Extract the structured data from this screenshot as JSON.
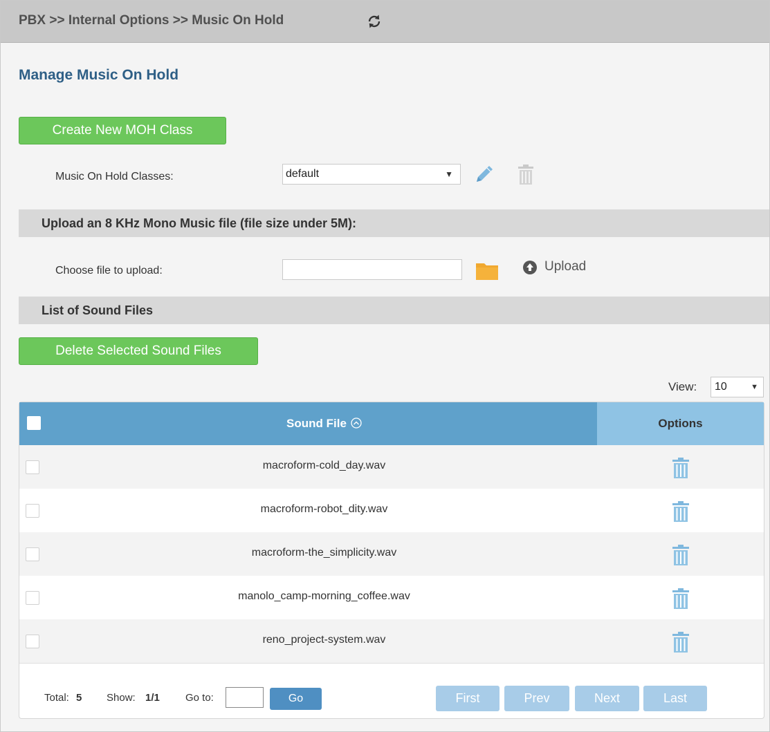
{
  "breadcrumb": "PBX >> Internal Options >> Music On Hold",
  "page_title": "Manage Music On Hold",
  "create_button": "Create New MOH Class",
  "moh_classes": {
    "label": "Music On Hold Classes:",
    "selected": "default"
  },
  "upload_section": {
    "title": "Upload an 8 KHz Mono Music file (file size under 5M):",
    "choose_label": "Choose file to upload:",
    "file_value": "",
    "upload_label": "Upload"
  },
  "list_section": {
    "title": "List of Sound Files"
  },
  "delete_button": "Delete Selected Sound Files",
  "view": {
    "label": "View:",
    "value": "10"
  },
  "table": {
    "headers": {
      "file": "Sound File",
      "options": "Options"
    },
    "rows": [
      {
        "file": "macroform-cold_day.wav"
      },
      {
        "file": "macroform-robot_dity.wav"
      },
      {
        "file": "macroform-the_simplicity.wav"
      },
      {
        "file": "manolo_camp-morning_coffee.wav"
      },
      {
        "file": "reno_project-system.wav"
      }
    ]
  },
  "pagination": {
    "total_label": "Total:",
    "total": "5",
    "show_label": "Show:",
    "show": "1/1",
    "goto_label": "Go to:",
    "goto_value": "",
    "go": "Go",
    "first": "First",
    "prev": "Prev",
    "next": "Next",
    "last": "Last"
  },
  "colors": {
    "header_blue": "#5fa1cb",
    "green_button": "#6cc75b",
    "title_blue": "#2e5f86"
  }
}
